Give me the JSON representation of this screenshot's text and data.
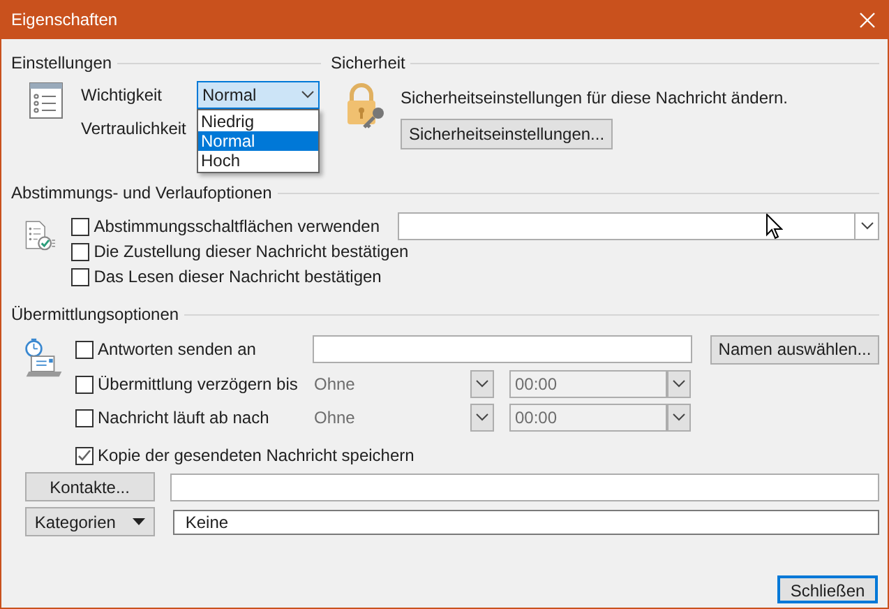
{
  "window": {
    "title": "Eigenschaften"
  },
  "settings": {
    "title": "Einstellungen",
    "importance": {
      "label": "Wichtigkeit",
      "value": "Normal",
      "expanded": true,
      "options": [
        {
          "label": "Niedrig",
          "selected": false
        },
        {
          "label": "Normal",
          "selected": true
        },
        {
          "label": "Hoch",
          "selected": false
        }
      ]
    },
    "sensitivity": {
      "label": "Vertraulichkeit"
    }
  },
  "security": {
    "title": "Sicherheit",
    "text": "Sicherheitseinstellungen für diese Nachricht ändern.",
    "button": "Sicherheitseinstellungen..."
  },
  "voting": {
    "title": "Abstimmungs- und Verlaufoptionen",
    "options": [
      {
        "label": "Abstimmungsschaltflächen verwenden",
        "checked": false
      },
      {
        "label": "Die Zustellung dieser Nachricht bestätigen",
        "checked": false
      },
      {
        "label": "Das Lesen dieser Nachricht bestätigen",
        "checked": false
      }
    ]
  },
  "delivery": {
    "title": "Übermittlungsoptionen",
    "reply_to": {
      "label": "Antworten senden an",
      "checked": false,
      "button": "Namen auswählen..."
    },
    "schedule": [
      {
        "label": "Übermittlung verzögern bis",
        "checked": false,
        "date": "Ohne",
        "time": "00:00"
      },
      {
        "label": "Nachricht läuft ab nach",
        "checked": false,
        "date": "Ohne",
        "time": "00:00"
      }
    ],
    "save_copy": {
      "label": "Kopie der gesendeten Nachricht speichern",
      "checked": true
    }
  },
  "contacts": {
    "button": "Kontakte..."
  },
  "categories": {
    "button": "Kategorien",
    "value": "Keine"
  },
  "close_button": "Schließen"
}
